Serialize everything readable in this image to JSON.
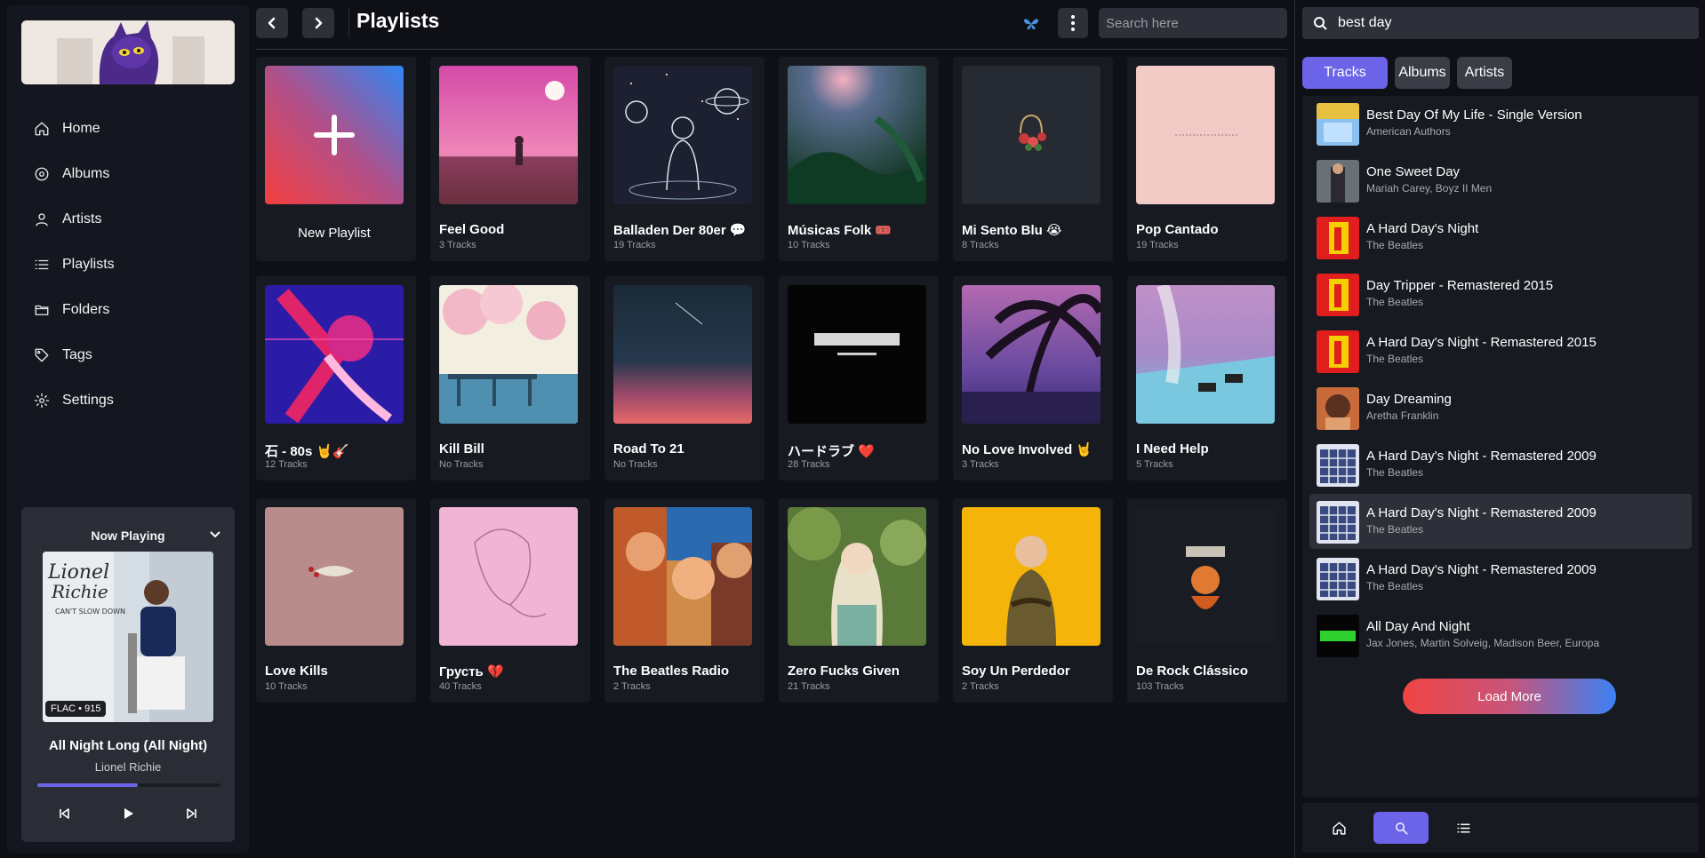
{
  "sidebar": {
    "nav": [
      {
        "label": "Home",
        "icon": "home-icon"
      },
      {
        "label": "Albums",
        "icon": "disc-icon"
      },
      {
        "label": "Artists",
        "icon": "user-icon"
      },
      {
        "label": "Playlists",
        "icon": "list-icon"
      },
      {
        "label": "Folders",
        "icon": "folder-icon"
      },
      {
        "label": "Tags",
        "icon": "tag-icon"
      },
      {
        "label": "Settings",
        "icon": "gear-icon"
      }
    ],
    "now_playing": {
      "header": "Now Playing",
      "badge": "FLAC • 915",
      "title": "All Night Long (All Night)",
      "artist": "Lionel Richie",
      "progress": 0.55
    }
  },
  "main": {
    "title": "Playlists",
    "search_placeholder": "Search here",
    "new_playlist_label": "New Playlist",
    "playlists": [
      {
        "title": "Feel Good",
        "tracks": "3 Tracks"
      },
      {
        "title": "Balladen Der 80er 💬",
        "tracks": "19 Tracks"
      },
      {
        "title": "Músicas Folk 🎟️",
        "tracks": "10 Tracks"
      },
      {
        "title": "Mi Sento Blu 😭",
        "tracks": "8 Tracks"
      },
      {
        "title": "Pop Cantado",
        "tracks": "19 Tracks"
      },
      {
        "title": "石 - 80s 🤘🎸",
        "tracks": "12 Tracks"
      },
      {
        "title": "Kill Bill",
        "tracks": "No Tracks"
      },
      {
        "title": "Road To 21",
        "tracks": "No Tracks"
      },
      {
        "title": "ハードラブ ❤️",
        "tracks": "28 Tracks"
      },
      {
        "title": "No Love Involved 🤘",
        "tracks": "3 Tracks"
      },
      {
        "title": "I Need Help",
        "tracks": "5 Tracks"
      },
      {
        "title": "Love Kills",
        "tracks": "10 Tracks"
      },
      {
        "title": "Грусть 💔",
        "tracks": "40 Tracks"
      },
      {
        "title": "The Beatles Radio",
        "tracks": "2 Tracks"
      },
      {
        "title": "Zero Fucks Given",
        "tracks": "21 Tracks"
      },
      {
        "title": "Soy Un Perdedor",
        "tracks": "2 Tracks"
      },
      {
        "title": "De Rock Clássico",
        "tracks": "103 Tracks"
      }
    ]
  },
  "right": {
    "search_value": "best day",
    "tabs": [
      "Tracks",
      "Albums",
      "Artists"
    ],
    "active_tab": "Tracks",
    "tracks": [
      {
        "title": "Best Day Of My Life - Single Version",
        "artist": "American Authors"
      },
      {
        "title": "One Sweet Day",
        "artist": "Mariah Carey, Boyz II Men"
      },
      {
        "title": "A Hard Day's Night",
        "artist": "The Beatles"
      },
      {
        "title": "Day Tripper - Remastered 2015",
        "artist": "The Beatles"
      },
      {
        "title": "A Hard Day's Night - Remastered 2015",
        "artist": "The Beatles"
      },
      {
        "title": "Day Dreaming",
        "artist": "Aretha Franklin"
      },
      {
        "title": "A Hard Day's Night - Remastered 2009",
        "artist": "The Beatles"
      },
      {
        "title": "A Hard Day's Night - Remastered 2009",
        "artist": "The Beatles"
      },
      {
        "title": "A Hard Day's Night - Remastered 2009",
        "artist": "The Beatles"
      },
      {
        "title": "All Day And Night",
        "artist": "Jax Jones, Martin Solveig, Madison Beer, Europa"
      }
    ],
    "load_more": "Load More"
  },
  "colors": {
    "accent": "#6b63e8",
    "background": "#0e1016",
    "card": "#171a21"
  }
}
